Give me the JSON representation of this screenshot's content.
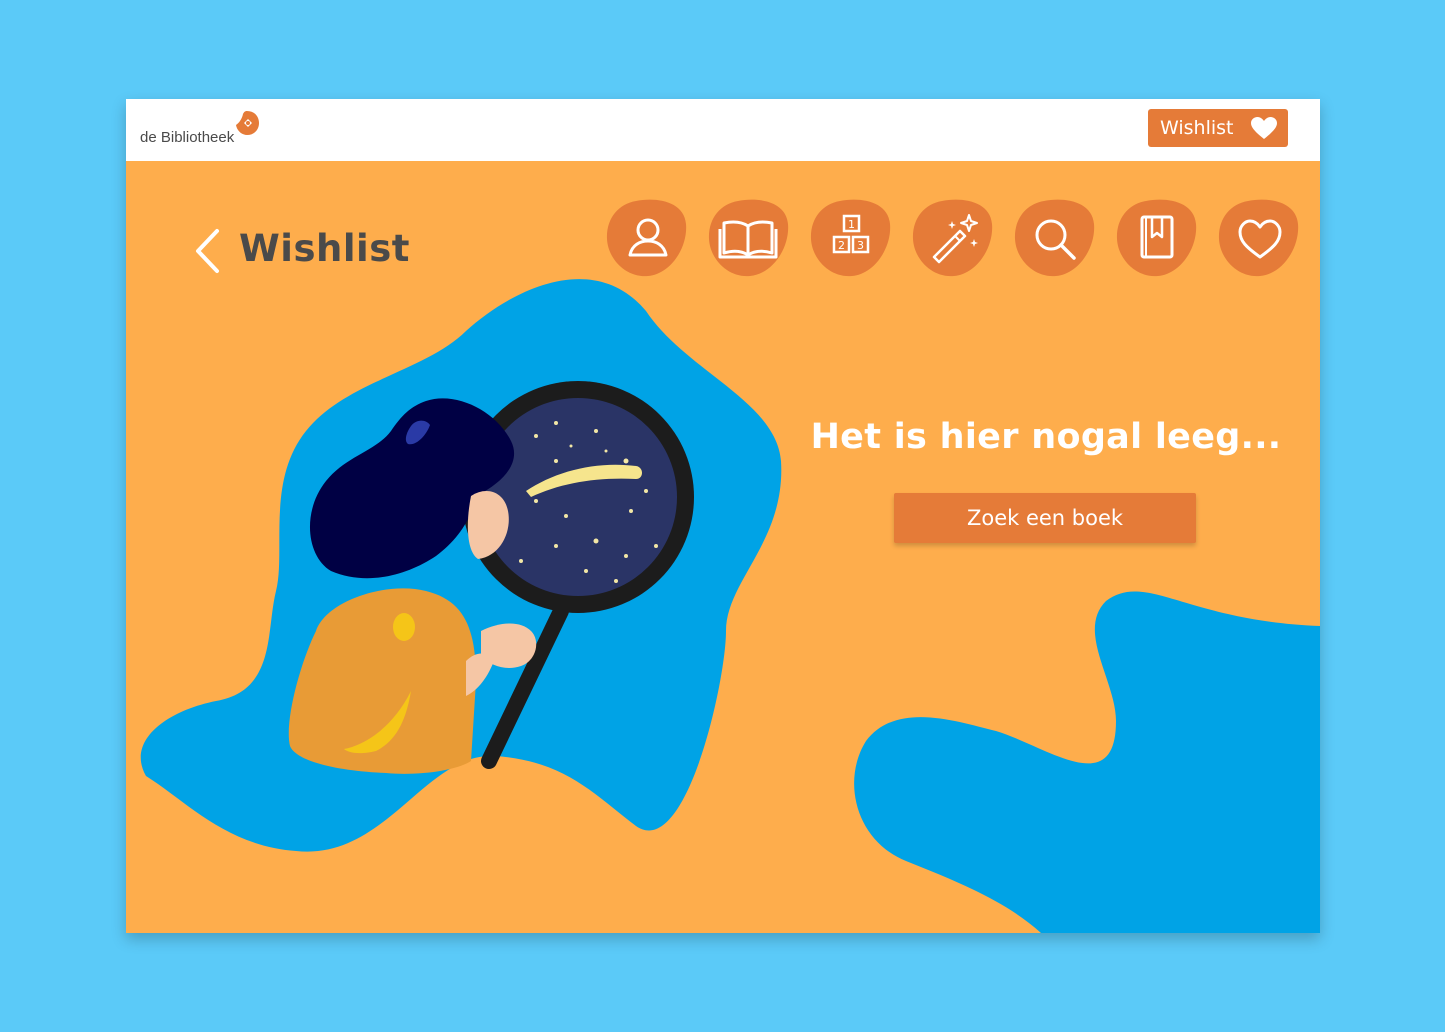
{
  "header": {
    "logo_text": "de Bibliotheek",
    "wishlist_button_label": "Wishlist"
  },
  "page": {
    "title": "Wishlist",
    "empty_message": "Het is hier nogal leeg...",
    "cta_label": "Zoek een boek"
  },
  "nav": {
    "items": [
      {
        "name": "profile",
        "icon": "user-icon"
      },
      {
        "name": "books",
        "icon": "open-book-icon"
      },
      {
        "name": "levels",
        "icon": "number-blocks-icon"
      },
      {
        "name": "magic",
        "icon": "magic-wand-icon"
      },
      {
        "name": "search",
        "icon": "search-icon"
      },
      {
        "name": "saved",
        "icon": "bookmark-book-icon"
      },
      {
        "name": "wishlist",
        "icon": "heart-icon"
      }
    ],
    "counter_digits": [
      "1",
      "2",
      "3"
    ]
  },
  "colors": {
    "background": "#5bcaf8",
    "panel": "#fead4c",
    "accent": "#e57b38",
    "blob": "#00a3e6",
    "hair": "#000044",
    "sky": "#2a3466"
  }
}
